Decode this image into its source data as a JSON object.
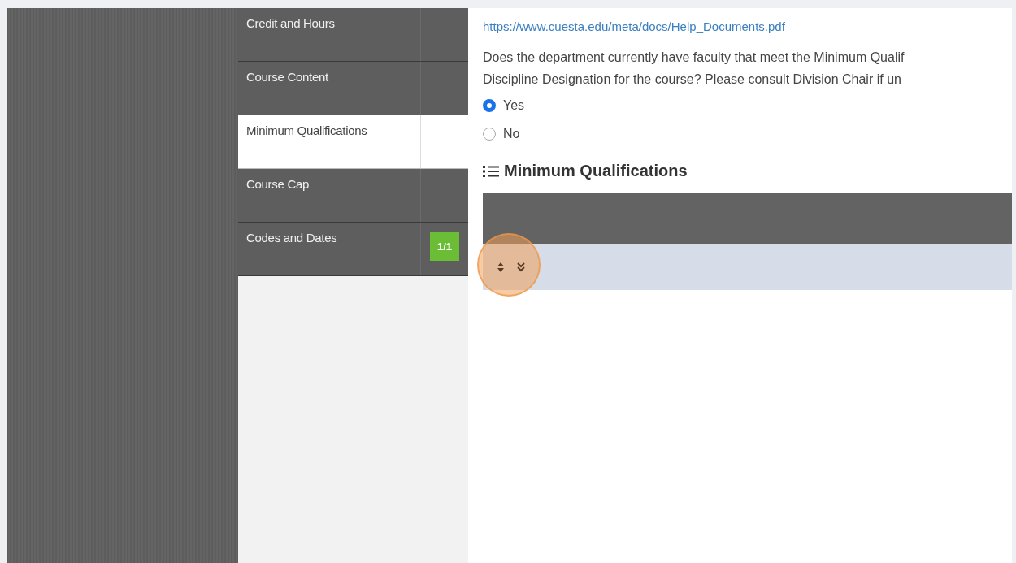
{
  "sidebar": {
    "items": [
      {
        "label": "Credit and Hours",
        "selected": false
      },
      {
        "label": "Course Content",
        "selected": false
      },
      {
        "label": "Minimum Qualifications",
        "selected": true
      },
      {
        "label": "Course Cap",
        "selected": false
      },
      {
        "label": "Codes and Dates",
        "selected": false,
        "badge": "1/1"
      }
    ]
  },
  "main": {
    "help_link": "https://www.cuesta.edu/meta/docs/Help_Documents.pdf",
    "question_lines": [
      "Does the department currently have faculty that meet the Minimum Qualif",
      "Discipline Designation for the course? Please consult Division Chair if un"
    ],
    "options": [
      {
        "label": "Yes",
        "selected": true
      },
      {
        "label": "No",
        "selected": false
      }
    ],
    "section": {
      "title": "Minimum Qualifications"
    }
  }
}
